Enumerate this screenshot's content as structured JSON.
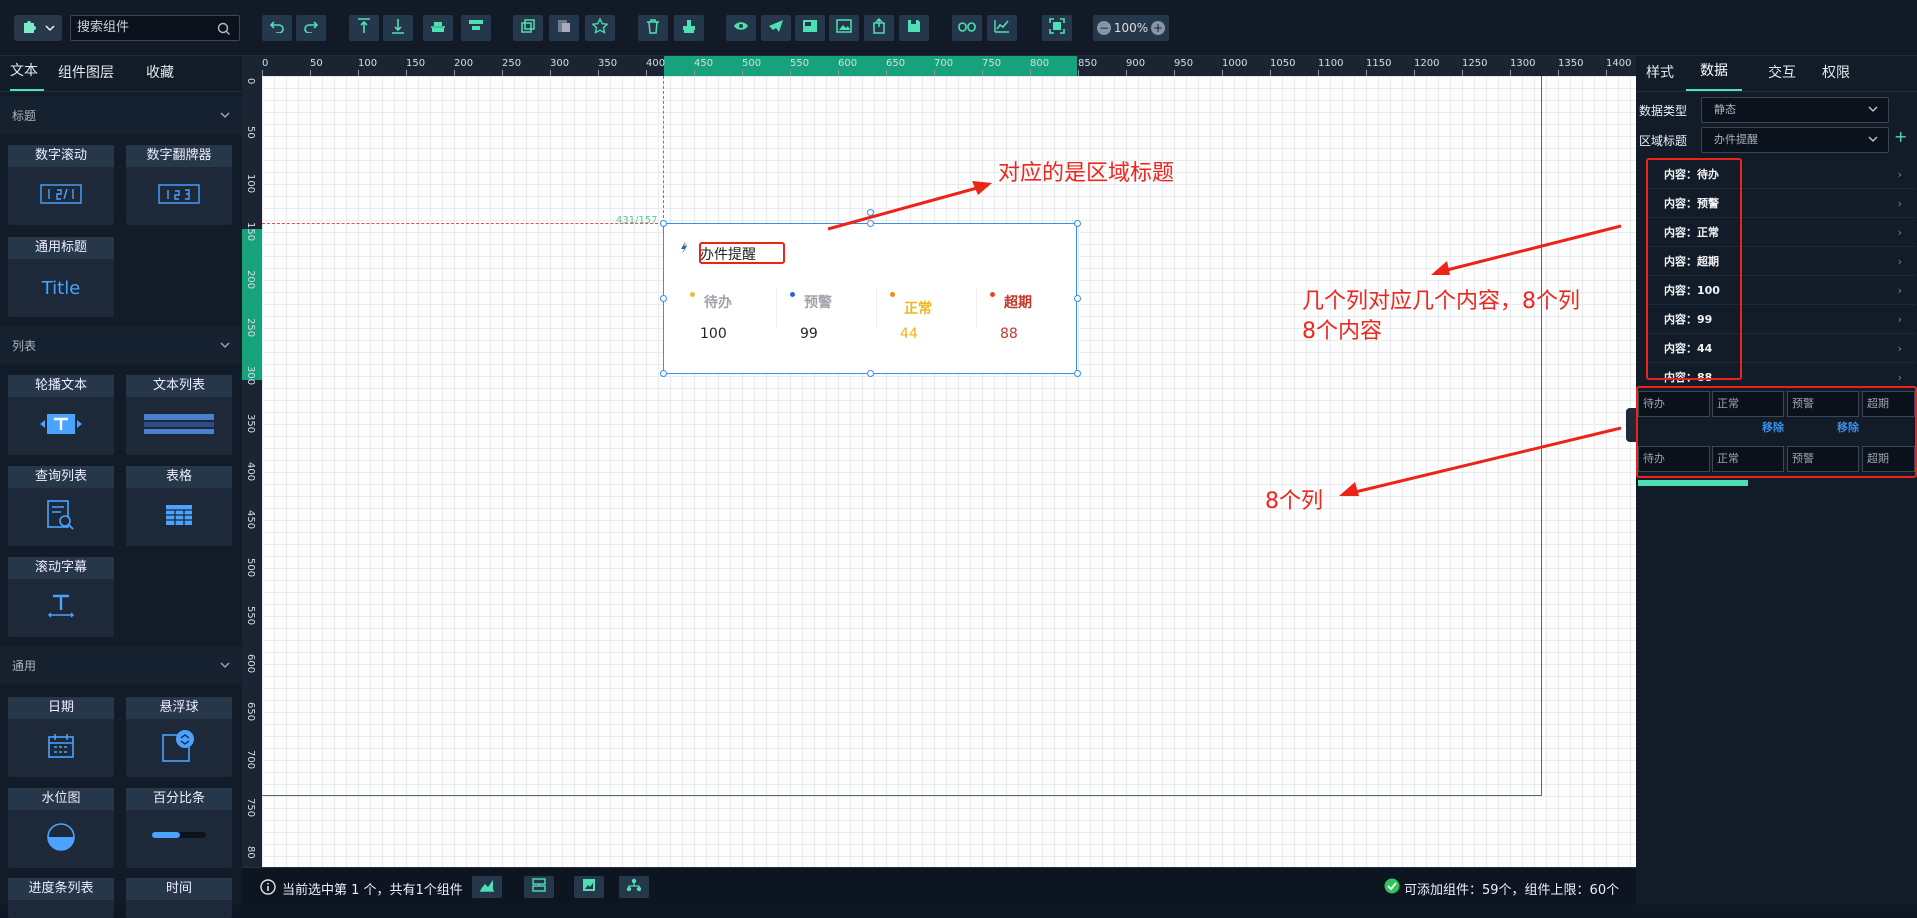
{
  "toolbar": {
    "search_placeholder": "搜索组件",
    "zoom_level": "100%",
    "zoom_minus": "−",
    "zoom_plus": "+",
    "buttons": [
      "undo-icon",
      "redo-icon",
      "align-top-icon",
      "align-bottom-icon",
      "align-hcenter-icon",
      "align-vcenter-icon",
      "copy-icon",
      "paste-icon",
      "favorite-icon",
      "delete-icon",
      "clear-icon",
      "preview-icon",
      "publish-icon",
      "image-frame-icon",
      "image-icon",
      "export-icon",
      "save-icon",
      "link-icon",
      "chart-icon",
      "fullscreen-icon"
    ]
  },
  "left_panel": {
    "tabs": [
      "文本",
      "组件图层",
      "收藏"
    ],
    "sections": {
      "title": "标题",
      "list": "列表",
      "common": "通用"
    },
    "cards": {
      "digital_scroll": "数字滚动",
      "digital_flip": "数字翻牌器",
      "general_title": "通用标题",
      "general_title_preview": "Title",
      "carousel_text": "轮播文本",
      "text_list": "文本列表",
      "query_list": "查询列表",
      "table": "表格",
      "marquee": "滚动字幕",
      "date": "日期",
      "float_ball": "悬浮球",
      "water_level": "水位图",
      "percentage": "百分比条",
      "progress_list": "进度条列表",
      "time": "时间"
    }
  },
  "ruler": {
    "h_ticks": [
      "0",
      "50",
      "100",
      "150",
      "200",
      "250",
      "300",
      "350",
      "400",
      "450",
      "500",
      "550",
      "600",
      "650",
      "700",
      "750",
      "800",
      "850",
      "900",
      "950",
      "1000",
      "1050",
      "1100",
      "1150",
      "1200",
      "1250",
      "1300",
      "1350",
      "1400",
      "14"
    ],
    "v_ticks": [
      "0",
      "50",
      "100",
      "150",
      "200",
      "250",
      "300",
      "350",
      "400",
      "450",
      "500",
      "550",
      "600",
      "650",
      "700",
      "750",
      "80"
    ],
    "coord_readout": "431/157"
  },
  "widget": {
    "title": "办件提醒",
    "columns": [
      {
        "label": "待办",
        "value": "100",
        "label_color": "#a0a4aa",
        "value_color": "#1f2530",
        "dot_color": "#f5b92a"
      },
      {
        "label": "预警",
        "value": "99",
        "label_color": "#a0a4aa",
        "value_color": "#1f2530",
        "dot_color": "#2a62e6"
      },
      {
        "label": "正常",
        "value": "44",
        "label_color": "#f2b51a",
        "value_color": "#f2b51a",
        "dot_color": "#f08a1a"
      },
      {
        "label": "超期",
        "value": "88",
        "label_color": "#c0392b",
        "value_color": "#c0392b",
        "dot_color": "#e8461c"
      }
    ]
  },
  "annotations": {
    "a1": "对应的是区域标题",
    "a2_line1": "几个列对应几个内容，8个列",
    "a2_line2": "8个内容",
    "a3": "8个列"
  },
  "status": {
    "selection": "当前选中第 1 个，共有1个组件",
    "capacity": "可添加组件：59个，组件上限：60个"
  },
  "right_panel": {
    "tabs": [
      "样式",
      "数据",
      "交互",
      "权限"
    ],
    "data_type_label": "数据类型",
    "data_type_value": "静态",
    "region_title_label": "区域标题",
    "region_title_value": "办件提醒",
    "add_symbol": "+",
    "content_rows": [
      "内容：待办",
      "内容：预警",
      "内容：正常",
      "内容：超期",
      "内容：100",
      "内容：99",
      "内容：44",
      "内容：88"
    ],
    "grid": {
      "row1": [
        "待办",
        "正常",
        "预警",
        "超期"
      ],
      "remove": "移除",
      "row3": [
        "待办",
        "正常",
        "预警",
        "超期"
      ]
    }
  },
  "colors": {
    "accent": "#4ee0b4",
    "annotation_red": "#ee2318",
    "selection_blue": "#3a8ee6"
  }
}
